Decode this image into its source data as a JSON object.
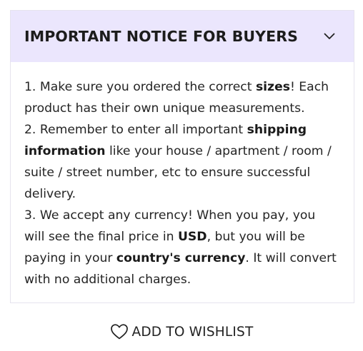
{
  "notice": {
    "title": "IMPORTANT NOTICE FOR BUYERS",
    "toggle_icon": "chevron-down-icon",
    "header_bg": "#ebe6fd",
    "lines": [
      [
        {
          "t": "1. Make sure you ordered the correct "
        },
        {
          "t": "sizes",
          "b": true
        },
        {
          "t": "! Each"
        }
      ],
      [
        {
          "t": "product has their own unique measurements."
        }
      ],
      [
        {
          "t": "2. Remember to enter all important "
        },
        {
          "t": "shipping",
          "b": true
        }
      ],
      [
        {
          "t": "information",
          "b": true
        },
        {
          "t": " like your house / apartment / room /"
        }
      ],
      [
        {
          "t": "suite / street number, etc to ensure successful"
        }
      ],
      [
        {
          "t": "delivery."
        }
      ],
      [
        {
          "t": "3. We accept any currency! When you pay, you"
        }
      ],
      [
        {
          "t": "will see the final price in "
        },
        {
          "t": "USD",
          "b": true
        },
        {
          "t": ", but you will be"
        }
      ],
      [
        {
          "t": "paying in your "
        },
        {
          "t": "country's currency",
          "b": true
        },
        {
          "t": ". It will convert"
        }
      ],
      [
        {
          "t": "with no additional charges."
        }
      ]
    ]
  },
  "wishlist": {
    "label": "ADD TO WISHLIST",
    "icon": "heart-icon"
  }
}
